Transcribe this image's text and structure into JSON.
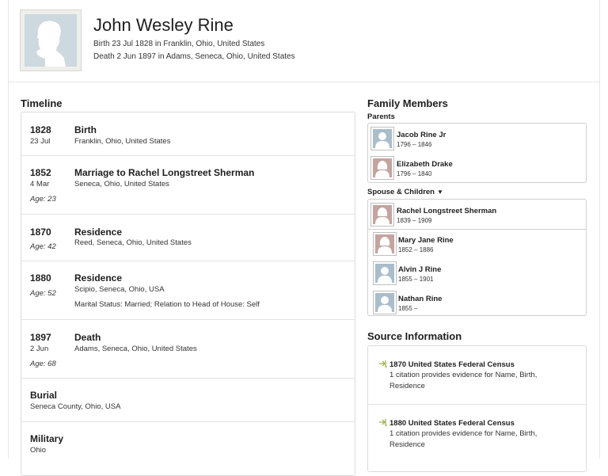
{
  "person": {
    "name": "John Wesley Rine",
    "birth": "Birth 23 Jul 1828 in Franklin, Ohio, United States",
    "death": "Death 2 Jun 1897 in Adams, Seneca, Ohio, United States"
  },
  "timeline": {
    "title": "Timeline",
    "events": [
      {
        "year": "1828",
        "date": "23 Jul",
        "event": "Birth",
        "place": "Franklin, Ohio, United States",
        "age": "",
        "extra": ""
      },
      {
        "year": "1852",
        "date": "4 Mar",
        "event": "Marriage to Rachel Longstreet Sherman",
        "place": "Seneca, Ohio, United States",
        "age": "Age: 23",
        "extra": ""
      },
      {
        "year": "1870",
        "date": "",
        "event": "Residence",
        "place": "Reed, Seneca, Ohio, United States",
        "age": "Age: 42",
        "extra": ""
      },
      {
        "year": "1880",
        "date": "",
        "event": "Residence",
        "place": "Scipio, Seneca, Ohio, USA",
        "age": "Age: 52",
        "extra": "Marital Status: Married; Relation to Head of House: Self"
      },
      {
        "year": "1897",
        "date": "2 Jun",
        "event": "Death",
        "place": "Adams, Seneca, Ohio, United States",
        "age": "Age: 68",
        "extra": ""
      }
    ],
    "burial": {
      "label": "Burial",
      "place": "Seneca County, Ohio, USA"
    },
    "military": {
      "label": "Military",
      "place": "Ohio"
    }
  },
  "family": {
    "title": "Family Members",
    "parents_label": "Parents",
    "parents": [
      {
        "name": "Jacob Rine Jr",
        "dates": "1796 – 1846",
        "gender": "male"
      },
      {
        "name": "Elizabeth Drake",
        "dates": "1796 – 1840",
        "gender": "female"
      }
    ],
    "spouse_label": "Spouse & Children",
    "spouse_caret": "▼",
    "spouse": {
      "name": "Rachel Longstreet Sherman",
      "dates": "1839 – 1909",
      "gender": "female"
    },
    "children": [
      {
        "name": "Mary Jane Rine",
        "dates": "1852 – 1886",
        "gender": "female"
      },
      {
        "name": "Alvin J Rine",
        "dates": "1855 – 1901",
        "gender": "male"
      },
      {
        "name": "Nathan Rine",
        "dates": "1855 –",
        "gender": "male"
      }
    ]
  },
  "sources": {
    "title": "Source Information",
    "items": [
      {
        "title": "1870 United States Federal Census",
        "desc": "1 citation provides evidence for Name, Birth, Residence"
      },
      {
        "title": "1880 United States Federal Census",
        "desc": "1 citation provides evidence for Name, Birth, Residence"
      }
    ]
  }
}
